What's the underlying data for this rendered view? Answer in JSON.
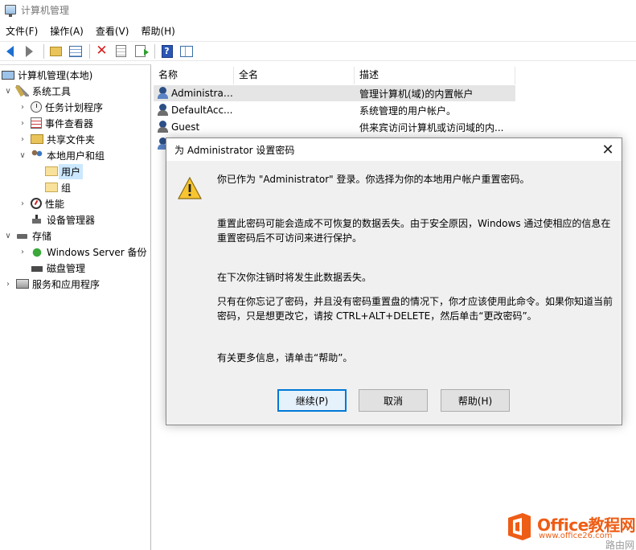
{
  "window": {
    "title": "计算机管理"
  },
  "menu": [
    "文件(F)",
    "操作(A)",
    "查看(V)",
    "帮助(H)"
  ],
  "tree": [
    {
      "label": "计算机管理(本地)",
      "toggle": "",
      "icon": "computer-icon",
      "level": 0
    },
    {
      "label": "系统工具",
      "toggle": "∨",
      "icon": "tools-icon",
      "level": 1
    },
    {
      "label": "任务计划程序",
      "toggle": "›",
      "icon": "clock-icon",
      "level": 2
    },
    {
      "label": "事件查看器",
      "toggle": "›",
      "icon": "event-viewer-icon",
      "level": 2
    },
    {
      "label": "共享文件夹",
      "toggle": "›",
      "icon": "shared-folder-icon",
      "level": 2
    },
    {
      "label": "本地用户和组",
      "toggle": "∨",
      "icon": "users-icon",
      "level": 2
    },
    {
      "label": "用户",
      "toggle": "",
      "icon": "folder-icon",
      "level": 3,
      "selected": true
    },
    {
      "label": "组",
      "toggle": "",
      "icon": "folder-icon",
      "level": 3
    },
    {
      "label": "性能",
      "toggle": "›",
      "icon": "performance-icon",
      "level": 2
    },
    {
      "label": "设备管理器",
      "toggle": "",
      "icon": "device-manager-icon",
      "level": 2
    },
    {
      "label": "存储",
      "toggle": "∨",
      "icon": "storage-icon",
      "level": 1
    },
    {
      "label": "Windows Server 备份",
      "toggle": "›",
      "icon": "backup-icon",
      "level": 2
    },
    {
      "label": "磁盘管理",
      "toggle": "",
      "icon": "disk-icon",
      "level": 2
    },
    {
      "label": "服务和应用程序",
      "toggle": "›",
      "icon": "services-icon",
      "level": 1
    }
  ],
  "list": {
    "columns": [
      "名称",
      "全名",
      "描述"
    ],
    "rows": [
      {
        "name": "Administrat...",
        "fullname": "",
        "description": "管理计算机(域)的内置帐户",
        "selected": true
      },
      {
        "name": "DefaultAcc...",
        "fullname": "",
        "description": "系统管理的用户帐户。"
      },
      {
        "name": "Guest",
        "fullname": "",
        "description": "供来宾访问计算机或访问域的内..."
      },
      {
        "name": "",
        "fullname": "",
        "description": ""
      }
    ]
  },
  "dialog": {
    "title": "为 Administrator 设置密码",
    "paragraphs": [
      "你已作为 \"Administrator\" 登录。你选择为你的本地用户帐户重置密码。",
      "重置此密码可能会造成不可恢复的数据丢失。由于安全原因，Windows 通过使相应的信息在",
      "重置密码后不可访问来进行保护。",
      "在下次你注销时将发生此数据丢失。",
      "只有在你忘记了密码，并且没有密码重置盘的情况下，你才应该使用此命令。如果你知道当前",
      "密码，只是想更改它，请按 CTRL+ALT+DELETE，然后单击“更改密码”。",
      "有关更多信息，请单击“帮助”。"
    ],
    "buttons": {
      "continue": "继续(P)",
      "cancel": "取消",
      "help": "帮助(H)"
    }
  },
  "watermark": {
    "brand": "Office教程网",
    "url": "www.office26.com",
    "site": "路由网"
  },
  "colors": {
    "accent": "#0078d7",
    "selection": "#cce8ff",
    "watermark": "#ee5d15"
  }
}
